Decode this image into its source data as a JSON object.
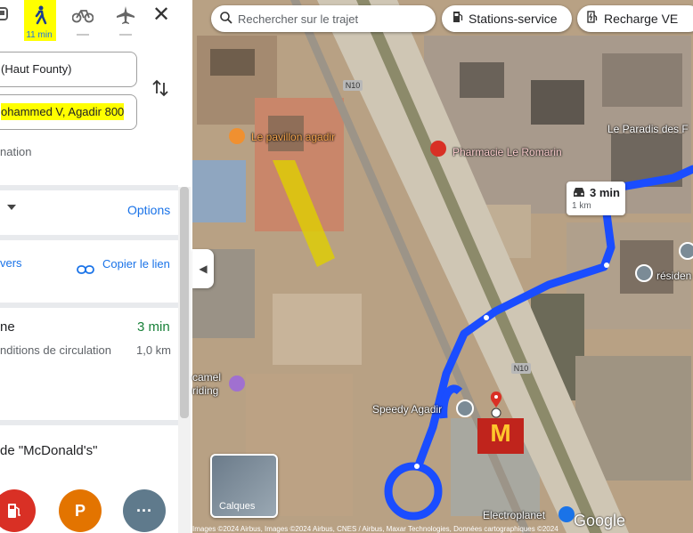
{
  "travel_modes": {
    "walk_time": "11 min"
  },
  "directions": {
    "from_value": "(Haut Founty)",
    "to_value": "ohammed V, Agadir 800",
    "add_destination": "nation"
  },
  "options": {
    "link": "Options"
  },
  "share": {
    "send_link": "vers",
    "copy_link": "Copier le lien"
  },
  "route": {
    "title": "ne",
    "time": "3 min",
    "subtitle": "nditions de circulation",
    "distance": "1,0 km"
  },
  "nearby": {
    "title": "de \"McDonald's\"",
    "more_label": "···",
    "parking_label": "P"
  },
  "map": {
    "search_placeholder": "Rechercher sur le trajet",
    "chip_fuel": "Stations-service",
    "chip_ev": "Recharge VE",
    "callout_time": "3 min",
    "callout_distance": "1 km",
    "labels": {
      "pavillon": "Le pavillon agadir",
      "pharmacie": "Pharmacie Le Romarin",
      "paradis": "Le Paradis des F",
      "speedy": "Speedy Agadir",
      "camel": "camel",
      "riding": "riding",
      "electroplanet": "Electroplanet",
      "residence": "résiden",
      "road_n10": "N10"
    },
    "layers_label": "Calques",
    "google_logo": "Google",
    "attribution": "Images ©2024 Airbus, Images ©2024 Airbus, CNES / Airbus, Maxar Technologies, Données cartographiques ©2024",
    "colors": {
      "route": "#1a4dff",
      "highlight": "#ffff00",
      "accent": "#1a73e8",
      "time_green": "#188038"
    }
  }
}
